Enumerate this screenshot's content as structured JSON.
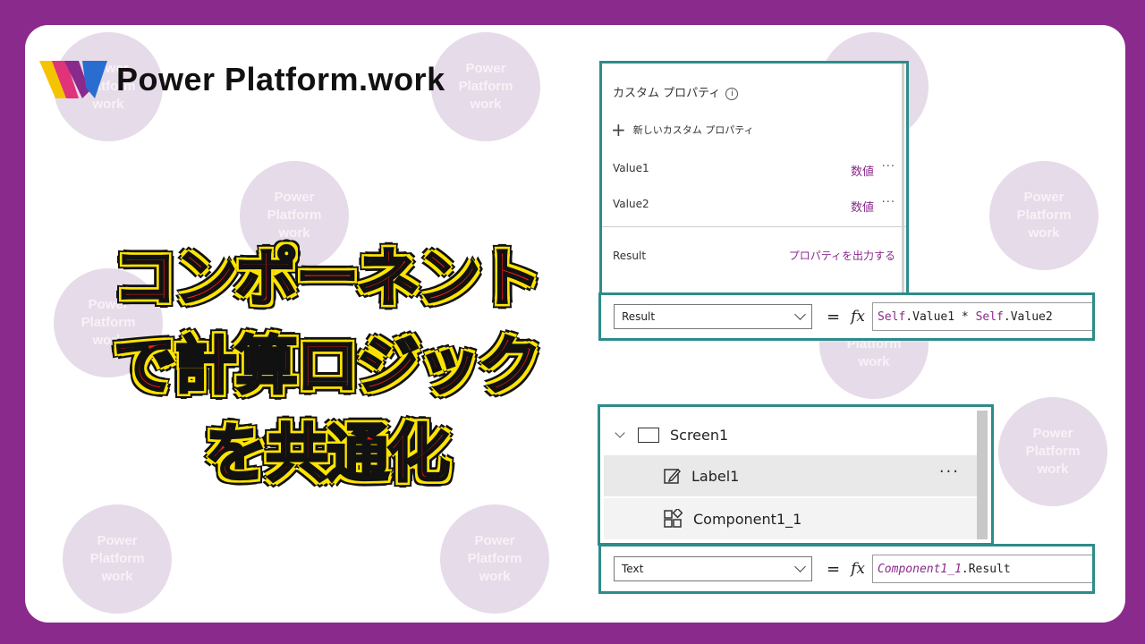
{
  "brand": {
    "name": "Power Platform.work",
    "watermark": "Power\nPlatform\nwork"
  },
  "headline": {
    "lines": [
      "コンポーネント",
      "で計算ロジック",
      "を共通化"
    ]
  },
  "custom_properties": {
    "title": "カスタム プロパティ",
    "info_icon": "info-icon",
    "new_property": "新しいカスタム プロパティ",
    "items": [
      {
        "name": "Value1",
        "type": "数値",
        "more": "···"
      },
      {
        "name": "Value2",
        "type": "数値",
        "more": "···"
      }
    ],
    "output": {
      "name": "Result",
      "action": "プロパティを出力する"
    }
  },
  "formula_bar_1": {
    "property": "Result",
    "equals": "=",
    "fx": "fx",
    "tokens": [
      {
        "text": "Self",
        "style": "kw"
      },
      {
        "text": ".Value1 * ",
        "style": "plain"
      },
      {
        "text": "Self",
        "style": "kw"
      },
      {
        "text": ".Value2",
        "style": "plain"
      }
    ]
  },
  "tree_view": {
    "items": [
      {
        "label": "Screen1",
        "icon": "screen-icon"
      },
      {
        "label": "Label1",
        "icon": "edit-label-icon",
        "more": "···"
      },
      {
        "label": "Component1_1",
        "icon": "component-icon"
      }
    ]
  },
  "formula_bar_2": {
    "property": "Text",
    "equals": "=",
    "fx": "fx",
    "tokens": [
      {
        "text": "Component1_1",
        "style": "kwi"
      },
      {
        "text": ".Result",
        "style": "plain"
      }
    ]
  },
  "colors": {
    "frame": "#8a2a8c",
    "headline_fill": "#ff1a1a",
    "headline_outline": "#ffe400",
    "panel_border": "#2e8b8b"
  }
}
